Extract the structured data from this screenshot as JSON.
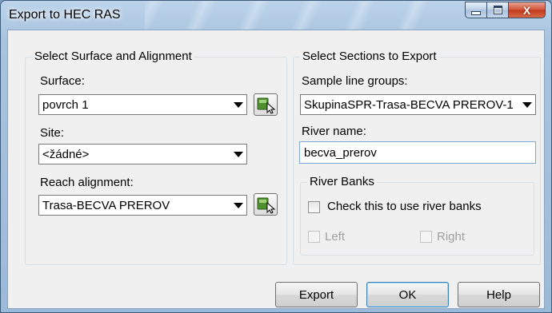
{
  "window": {
    "title": "Export to HEC RAS",
    "close_glyph": "X"
  },
  "left_group": {
    "title": "Select Surface and Alignment",
    "surface_label": "Surface:",
    "surface_value": "povrch 1",
    "site_label": "Site:",
    "site_value": "<žádné>",
    "reach_label": "Reach alignment:",
    "reach_value": "Trasa-BECVA PRERO​V"
  },
  "right_group": {
    "title": "Select Sections to Export",
    "sample_lines_label": "Sample line groups:",
    "sample_lines_value": "SkupinaSPR-Trasa-BECVA PREROV-1",
    "river_name_label": "River name:",
    "river_name_value": "becva_prerov",
    "river_banks": {
      "title": "River Banks",
      "use_banks_label": "Check this to use river banks",
      "left_label": "Left",
      "right_label": "Right"
    }
  },
  "buttons": {
    "export": "Export",
    "ok": "OK",
    "help": "Help"
  },
  "icons": {
    "pick_surface": "select-from-drawing-icon",
    "pick_alignment": "select-from-drawing-icon"
  },
  "colors": {
    "title_bar": "#a9c4e0",
    "close_button": "#c8452a",
    "dialog_face": "#f0f0f0",
    "pick_icon_green": "#4f8f2f"
  }
}
